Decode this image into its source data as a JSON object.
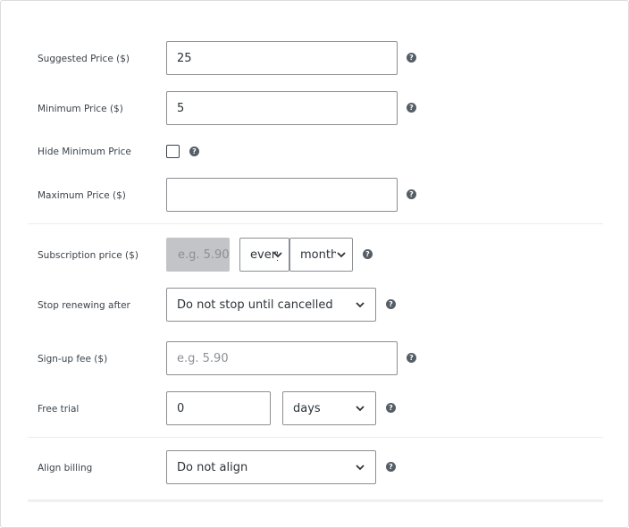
{
  "fields": {
    "suggested_price": {
      "label": "Suggested Price ($)",
      "value": "25"
    },
    "minimum_price": {
      "label": "Minimum Price ($)",
      "value": "5"
    },
    "hide_minimum_price": {
      "label": "Hide Minimum Price",
      "checked": false
    },
    "maximum_price": {
      "label": "Maximum Price ($)",
      "value": ""
    },
    "subscription_price": {
      "label": "Subscription price ($)",
      "placeholder": "e.g. 5.90",
      "interval": "every",
      "period": "month"
    },
    "stop_renewing": {
      "label": "Stop renewing after",
      "value": "Do not stop until cancelled"
    },
    "signup_fee": {
      "label": "Sign-up fee ($)",
      "placeholder": "e.g. 5.90"
    },
    "free_trial": {
      "label": "Free trial",
      "value": "0",
      "unit": "days"
    },
    "align_billing": {
      "label": "Align billing",
      "value": "Do not align"
    }
  },
  "help_glyph": "?",
  "icons": {
    "help": "question-circle-icon",
    "dropdown": "chevron-down-icon"
  }
}
